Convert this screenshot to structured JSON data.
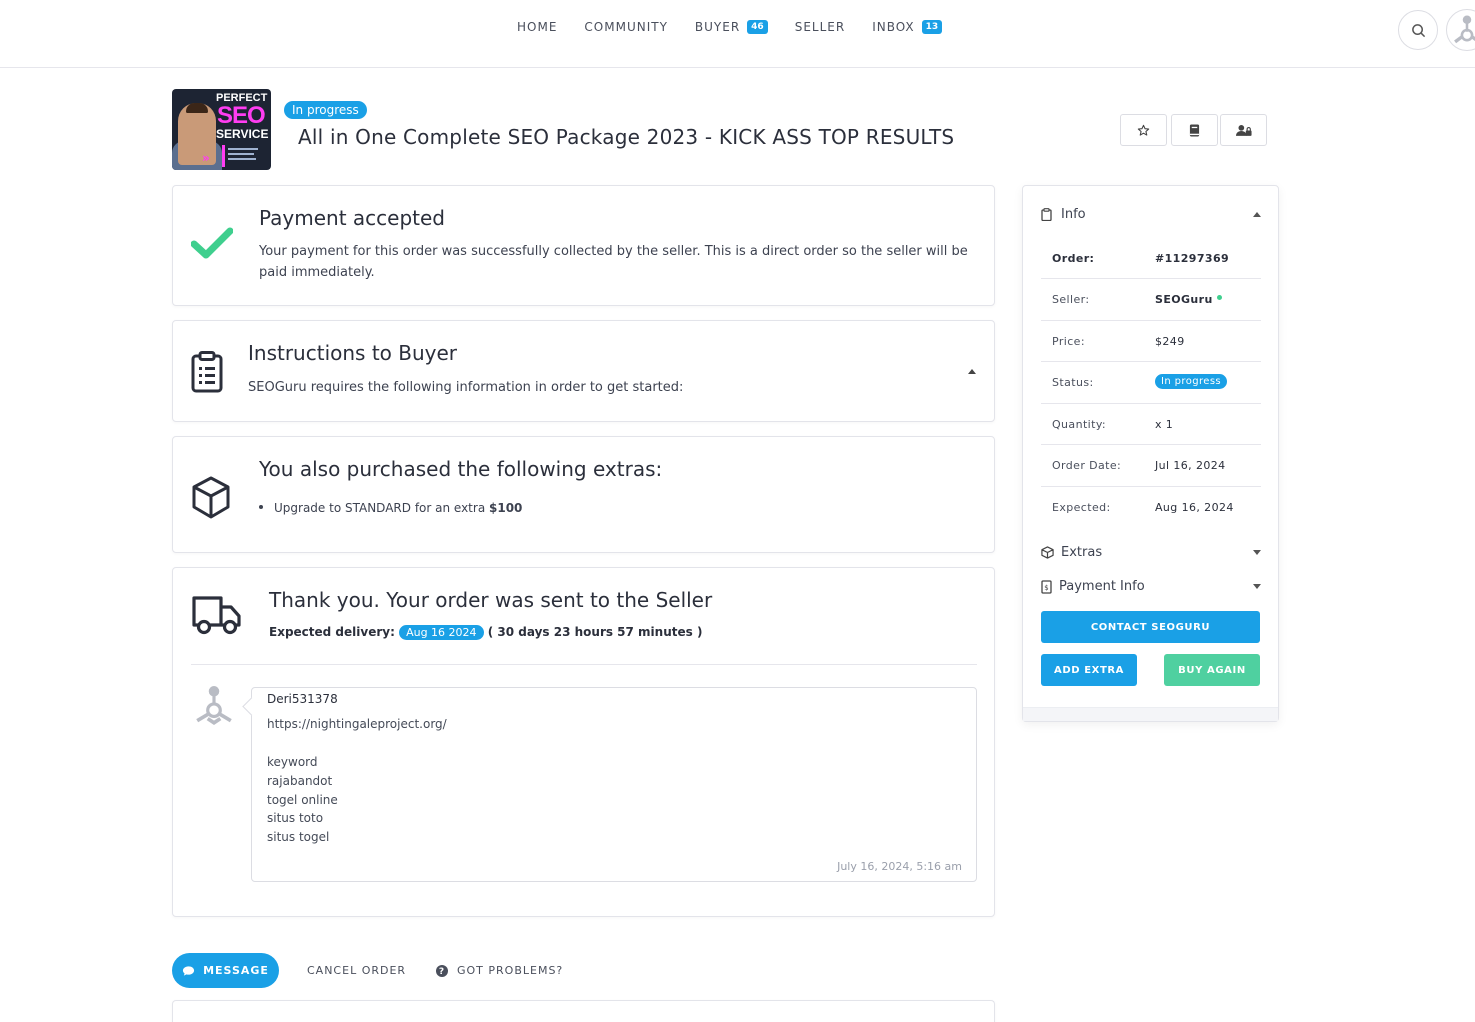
{
  "nav": {
    "home": "HOME",
    "community": "COMMUNITY",
    "buyer": "BUYER",
    "buyer_count": "46",
    "seller": "SELLER",
    "inbox": "INBOX",
    "inbox_count": "13"
  },
  "header": {
    "thumb": {
      "line1": "PERFECT",
      "line2": "SEO",
      "line3": "SERVICE"
    },
    "status_badge": "In progress",
    "title": "All in One Complete SEO Package 2023 - KICK ASS TOP RESULTS",
    "icons": [
      "star-icon",
      "book-icon",
      "user-lock-icon"
    ]
  },
  "payment": {
    "title": "Payment accepted",
    "text": "Your payment for this order was successfully collected by the seller. This is a direct order so the seller will be paid immediately."
  },
  "instructions": {
    "title": "Instructions to Buyer",
    "text": "SEOGuru requires the following information in order to get started:"
  },
  "extras": {
    "title": "You also purchased the following extras:",
    "item_text": "Upgrade to STANDARD for an extra",
    "item_price": "$100"
  },
  "delivery": {
    "title": "Thank you. Your order was sent to the Seller",
    "label": "Expected delivery:",
    "date_badge": "Aug 16 2024",
    "remaining": "( 30 days 23 hours 57 minutes )"
  },
  "message": {
    "author": "Deri531378",
    "lines": [
      "https://nightingaleproject.org/",
      "",
      "keyword",
      "rajabandot",
      "togel online",
      "situs toto",
      "situs togel"
    ],
    "time": "July 16, 2024, 5:16 am"
  },
  "actions": {
    "message": "MESSAGE",
    "cancel": "CANCEL ORDER",
    "problems": "GOT PROBLEMS?"
  },
  "sidebar": {
    "info_title": "Info",
    "order_label": "Order:",
    "order_value": "#11297369",
    "seller_label": "Seller:",
    "seller_value": "SEOGuru",
    "price_label": "Price:",
    "price_value": "$249",
    "status_label": "Status:",
    "status_value": "In progress",
    "quantity_label": "Quantity:",
    "quantity_value": "x 1",
    "order_date_label": "Order Date:",
    "order_date_value": "Jul 16, 2024",
    "expected_label": "Expected:",
    "expected_value": "Aug 16, 2024",
    "extras_title": "Extras",
    "payment_title": "Payment Info",
    "contact_btn": "CONTACT SEOGURU",
    "add_extra_btn": "ADD EXTRA",
    "buy_again_btn": "BUY AGAIN"
  },
  "colors": {
    "accent": "#1aa0e6",
    "success": "#3fcf8e",
    "text": "#2b2f3b"
  }
}
